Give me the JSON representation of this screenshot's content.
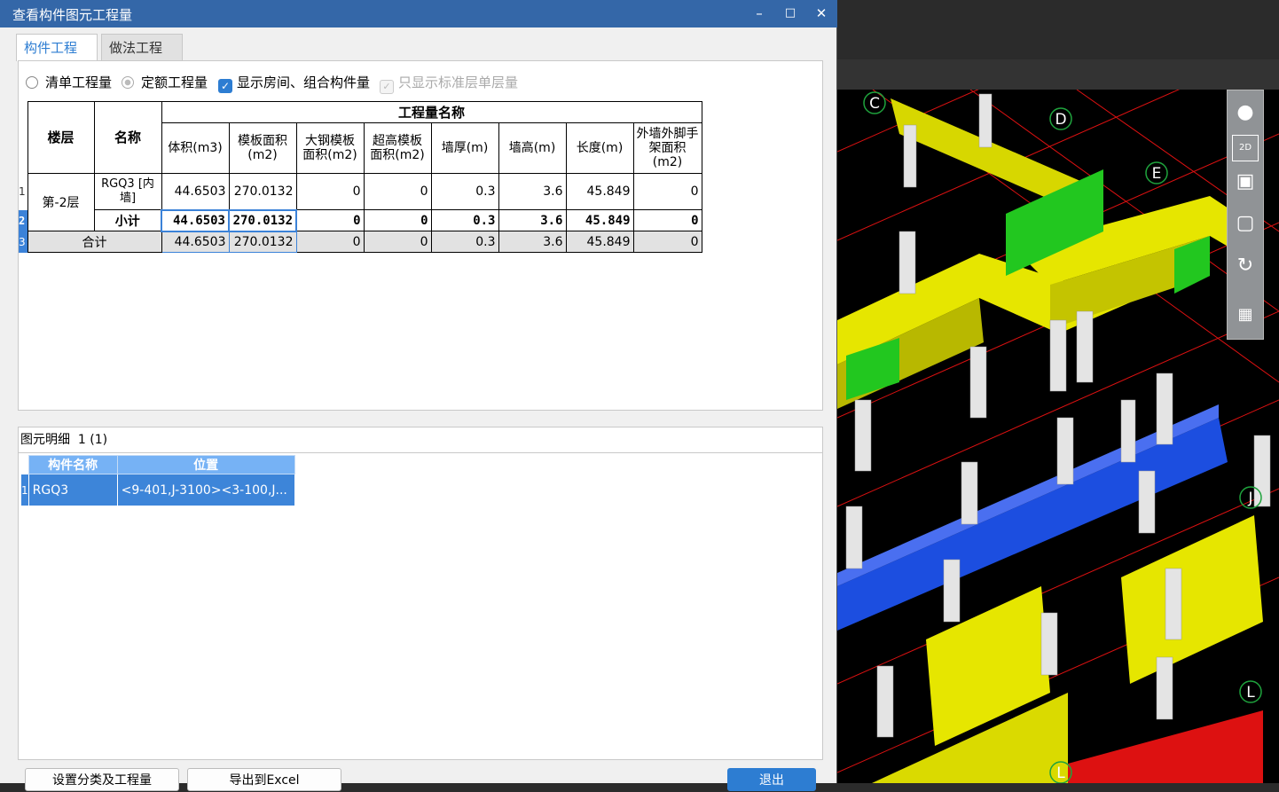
{
  "window": {
    "title": "查看构件图元工程量"
  },
  "tabs": [
    {
      "label": "构件工程量",
      "active": true
    },
    {
      "label": "做法工程量",
      "active": false
    }
  ],
  "options": {
    "radio_list": "清单工程量",
    "radio_quota": "定额工程量",
    "check_show_rooms": "显示房间、组合构件量",
    "check_std_layer": "只显示标准层单层量"
  },
  "table": {
    "group_header": "工程量名称",
    "col_floor": "楼层",
    "col_name": "名称",
    "columns": [
      "体积(m3)",
      "模板面积(m2)",
      "大钢模板面积(m2)",
      "超高模板面积(m2)",
      "墙厚(m)",
      "墙高(m)",
      "长度(m)",
      "外墙外脚手架面积(m2)"
    ],
    "rows": [
      {
        "num": "1",
        "floor": "第-2层",
        "name": "RGQ3 [内墙]",
        "values": [
          "44.6503",
          "270.0132",
          "0",
          "0",
          "0.3",
          "3.6",
          "45.849",
          "0"
        ]
      },
      {
        "num": "2",
        "floor": "",
        "name": "小计",
        "values": [
          "44.6503",
          "270.0132",
          "0",
          "0",
          "0.3",
          "3.6",
          "45.849",
          "0"
        ]
      },
      {
        "num": "3",
        "floor": "",
        "name": "合计",
        "values": [
          "44.6503",
          "270.0132",
          "0",
          "0",
          "0.3",
          "3.6",
          "45.849",
          "0"
        ]
      }
    ]
  },
  "detail": {
    "header": "图元明细",
    "count": "1 (1)",
    "columns": [
      "构件名称",
      "位置"
    ],
    "rows": [
      {
        "num": "1",
        "name": "RGQ3",
        "position": "<9-401,J-3100><3-100,J..."
      }
    ]
  },
  "buttons": {
    "classify": "设置分类及工程量",
    "export": "导出到Excel",
    "exit": "退出"
  },
  "viewport": {
    "axis_labels": [
      "C",
      "D",
      "E",
      "J",
      "L",
      "L"
    ],
    "toolbar_icons": [
      "globe-icon",
      "2d-view-icon",
      "box-top-icon",
      "box-iso-icon",
      "rotate-icon",
      "grid-settings-icon"
    ],
    "toolbar_2d_label": "2D"
  },
  "colors": {
    "accent": "#2d7dd2",
    "titlebar": "#3467a8",
    "wall": "#e6e600",
    "wall_blue": "#1c4ee0",
    "wall_green": "#22c71f"
  }
}
